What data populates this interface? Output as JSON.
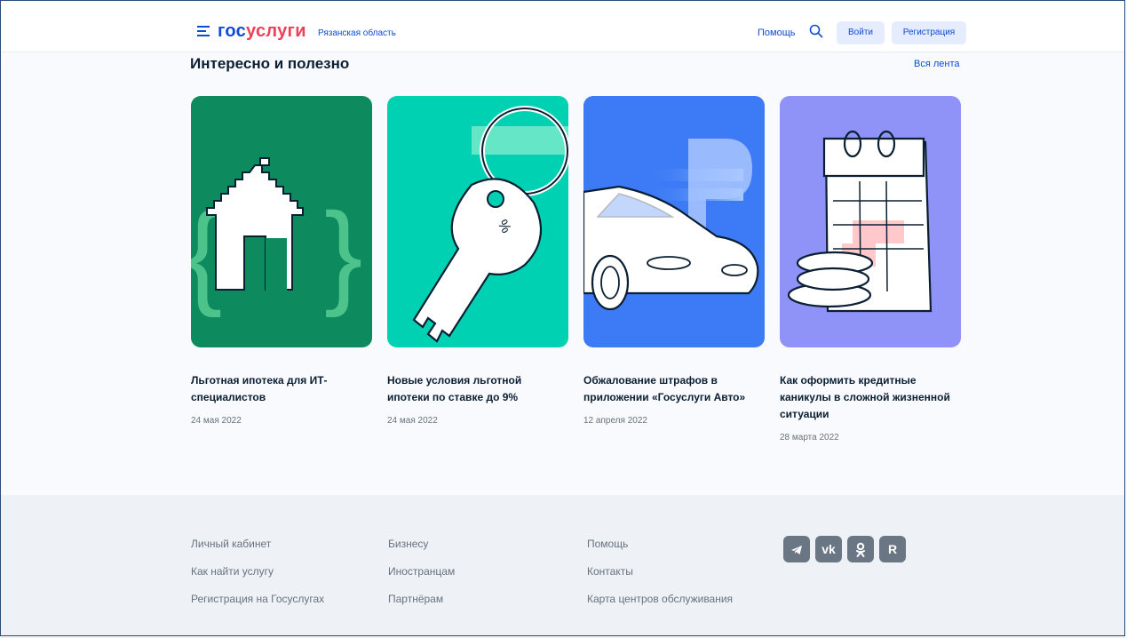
{
  "header": {
    "logo_part1": "гос",
    "logo_part2": "услуги",
    "region": "Рязанская область",
    "help": "Помощь",
    "login": "Войти",
    "register": "Регистрация"
  },
  "feed": {
    "title": "Интересно и полезно",
    "all_link": "Вся лента",
    "cards": [
      {
        "title": "Льготная ипотека для ИТ-специалистов",
        "date": "24 мая 2022",
        "bg": "#0e8a5f"
      },
      {
        "title": "Новые условия льготной ипотеки по ставке до 9%",
        "date": "24 мая 2022",
        "bg": "#00d1b2"
      },
      {
        "title": "Обжалование штрафов в приложении «Госуслуги Авто»",
        "date": "12 апреля 2022",
        "bg": "#3c7bf5"
      },
      {
        "title": "Как оформить кредитные каникулы в сложной жизненной ситуации",
        "date": "28 марта 2022",
        "bg": "#8f93f7"
      }
    ]
  },
  "footer": {
    "col1": [
      "Личный кабинет",
      "Как найти услугу",
      "Регистрация на Госуслугах"
    ],
    "col2": [
      "Бизнесу",
      "Иностранцам",
      "Партнёрам"
    ],
    "col3": [
      "Помощь",
      "Контакты",
      "Карта центров обслуживания"
    ],
    "social": [
      {
        "icon": "telegram-icon"
      },
      {
        "icon": "vk-icon"
      },
      {
        "icon": "ok-icon"
      },
      {
        "icon": "rutube-icon"
      }
    ]
  }
}
